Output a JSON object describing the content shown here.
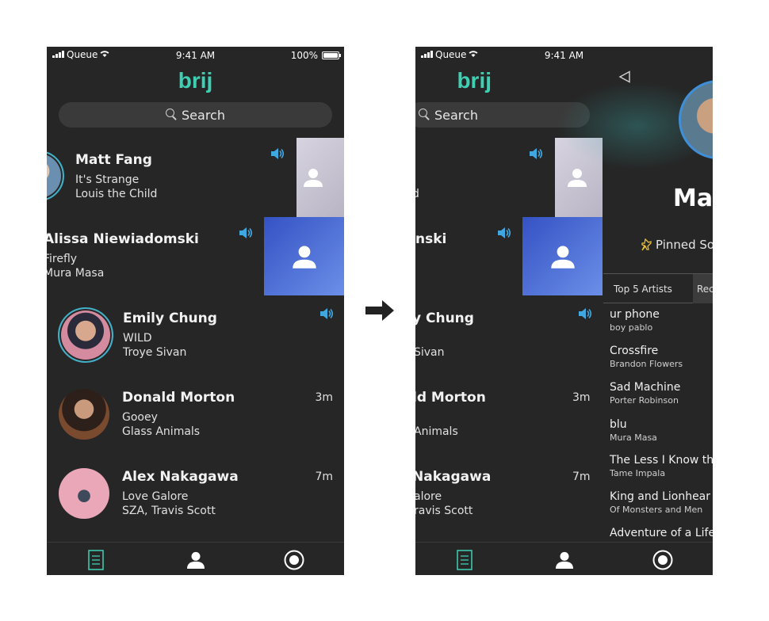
{
  "status": {
    "carrier": "Queue",
    "time": "9:41 AM",
    "battery": "100%"
  },
  "app": {
    "logo": "brij"
  },
  "search": {
    "placeholder": "Search"
  },
  "feed": [
    {
      "name": "Matt Fang",
      "song": "It's Strange",
      "artist": "Louis the Child",
      "ago": ""
    },
    {
      "name": "Alissa Niewiadomski",
      "song": "Firefly",
      "artist": "Mura Masa",
      "ago": ""
    },
    {
      "name": "Emily Chung",
      "song": "WILD",
      "artist": "Troye Sivan",
      "ago": ""
    },
    {
      "name": "Donald Morton",
      "song": "Gooey",
      "artist": "Glass Animals",
      "ago": "3m"
    },
    {
      "name": "Alex Nakagawa",
      "song": "Love Galore",
      "artist": "SZA, Travis Scott",
      "ago": "7m"
    }
  ],
  "feed_right": [
    {
      "name": "",
      "song": "",
      "artist": "d",
      "ago": ""
    },
    {
      "name": "nski",
      "song": "",
      "artist": "",
      "ago": ""
    },
    {
      "name": "y Chung",
      "song": "",
      "artist": "Sivan",
      "ago": ""
    },
    {
      "name": "ld Morton",
      "song": "",
      "artist": "Animals",
      "ago": "3m"
    },
    {
      "name": "Nakagawa",
      "song": "alore",
      "artist": "ravis Scott",
      "ago": "7m"
    }
  ],
  "profile": {
    "name": "Mat",
    "pinned_label": "Pinned So",
    "tabs": [
      "Top 5 Artists",
      "Rec"
    ],
    "songs": [
      {
        "title": "ur phone",
        "artist": "boy pablo"
      },
      {
        "title": "Crossfire",
        "artist": "Brandon Flowers"
      },
      {
        "title": "Sad Machine",
        "artist": "Porter Robinson"
      },
      {
        "title": "blu",
        "artist": "Mura Masa"
      },
      {
        "title": "The Less I Know th",
        "artist": "Tame Impala"
      },
      {
        "title": "King and Lionhear",
        "artist": "Of Monsters and Men"
      },
      {
        "title": "Adventure of a Life",
        "artist": ""
      }
    ]
  },
  "colors": {
    "accent": "#3fd0b4",
    "speaker": "#3fa8e0",
    "background": "#262626",
    "card_blue": "#3552c4"
  }
}
